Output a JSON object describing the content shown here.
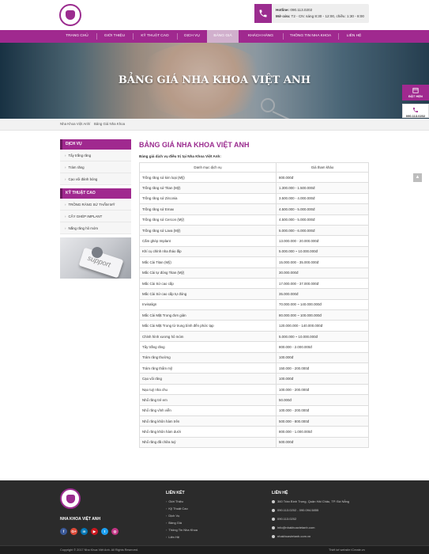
{
  "header": {
    "logo_icon": "tooth-logo",
    "hotline_label": "Hotline:",
    "hotline_value": "090.113.0202",
    "hours_label": "Mở cửa:",
    "hours_value": "T2 - CN: sáng 8:30 - 12:00, chiều: 1:30 - 8:00"
  },
  "nav": {
    "items": [
      {
        "label": "Trang chủ"
      },
      {
        "label": "Giới thiệu"
      },
      {
        "label": "Kỹ thuật cao"
      },
      {
        "label": "Dịch vụ"
      },
      {
        "label": "Bảng giá"
      },
      {
        "label": "Khách hàng"
      },
      {
        "label": "Thông tin nha khoa"
      },
      {
        "label": "Liên hệ"
      }
    ],
    "active_index": 4
  },
  "banner": {
    "title": "BẢNG GIÁ NHA KHOA VIỆT ANH"
  },
  "float_buttons": {
    "book_label": "ĐẶT HẸN",
    "call_label": "090.113.0202"
  },
  "breadcrumb": {
    "home": "Nha Khoa Việt Anh",
    "separator": "/",
    "current": "Bảng Giá Nha Khoa"
  },
  "sidebar": {
    "section1_title": "Dịch vụ",
    "section1_items": [
      "Tẩy trắng răng",
      "Trám răng",
      "Cạo vôi đánh bóng"
    ],
    "section2_title": "Kỹ thuật cao",
    "section2_items": [
      "TRỒNG RĂNG SỨ THẨM MỸ",
      "CẤY GHÉP IMPLANT",
      "Nắng răng hô móm"
    ],
    "support_text": "support"
  },
  "main": {
    "title": "BẢNG GIÁ NHA KHOA VIỆT ANH",
    "subtitle": "Bảng giá dịch vụ điều trị tại Nha Khoa Việt Anh:",
    "col_service": "Danh mục dịch vụ",
    "col_price": "Giá tham khảo",
    "rows": [
      [
        "Trồng răng sứ kim loại (Mỹ)",
        "800.000đ"
      ],
      [
        "Trồng răng sứ Titan (Mỹ)",
        "1.300.000 - 1.500.000đ"
      ],
      [
        "Trồng răng sứ Zirconia",
        "3.500.000 - 4.000.000đ"
      ],
      [
        "Trồng răng sứ Emax",
        "4.500.000 - 5.000.000đ"
      ],
      [
        "Trồng răng sứ Cercon (Mỹ)",
        "4.500.000 - 5.000.000đ"
      ],
      [
        "Trồng răng sứ Lava (Mỹ)",
        "5.000.000 - 6.000.000đ"
      ],
      [
        "Cấm ghép Implant",
        "13.000.000 - 20.000.000đ"
      ],
      [
        "Khí cụ chỉnh nha tháo lắp",
        "5.000.000 ~ 10.000.000đ"
      ],
      [
        "Mắc Cài Titan (Mỹ)",
        "15.000.000 - 35.000.000đ"
      ],
      [
        "Mắc Cài tự đóng Titan (Mỹ)",
        "30.000.000đ"
      ],
      [
        "Mắc Cài Sứ cao cấp",
        "17.000.000 - 37.000.000đ"
      ],
      [
        "Mắc Cài Sứ cao cấp tự đóng",
        "35.000.000đ"
      ],
      [
        "Invisalign",
        "70.000.000 ~ 140.000.000đ"
      ],
      [
        "Mắc Cài Mặt Trong đơn giản",
        "80.000.000 ~ 100.000.000đ"
      ],
      [
        "Mắc Cài Mặt Trong từ trung bình đến phức tạp",
        "120.000.000 - 140.000.000đ"
      ],
      [
        "Chỉnh hình xương hô móm",
        "5.000.000 ~ 10.000.000đ"
      ],
      [
        "Tẩy trắng răng",
        "800.000 - 2.000.000đ"
      ],
      [
        "Trám răng thường",
        "100.000đ"
      ],
      [
        "Trám răng thẩm mỹ",
        "150.000 - 200.000đ"
      ],
      [
        "Cạo vôi răng",
        "100.000đ"
      ],
      [
        "Nạo tuỷ nha chu",
        "100.000 - 200.000đ"
      ],
      [
        "Nhổ răng trẻ em",
        "50.000đ"
      ],
      [
        "Nhổ răng vĩnh viễn",
        "100.000 - 200.000đ"
      ],
      [
        "Nhổ răng khôn hàm trên",
        "500.000 - 800.000đ"
      ],
      [
        "Nhổ răng khôn hàm dưới",
        "800.000 - 1.000.000đ"
      ],
      [
        "Nhổ răng đã chữa tuỷ",
        "500.000đ"
      ]
    ]
  },
  "footer": {
    "brand": "NHA KHOA VIỆT ANH",
    "social": [
      "f",
      "G+",
      "in",
      "▶",
      "t",
      "◎"
    ],
    "links_title": "Liên kết",
    "links": [
      "Giới Thiệu",
      "Kỹ Thuật Cao",
      "Dịch Vụ",
      "Bảng Giá",
      "Thông Tin Nha Khoa",
      "Liên Hệ"
    ],
    "contact_title": "Liên hệ",
    "contact": [
      "360 Trần Bình Trọng, Quận Hải Châu, TP. Đà Nẵng",
      "090.113.0202 - 090.094.5855",
      "090.113.0202",
      "info@nhakhoavietanh.com",
      "nhakhoavietanh.com.vn"
    ],
    "copyright": "Copyright © 2017 Nha Khoa Việt Anh. All Rights Reserved.",
    "credit": "Thiết kế website iCreate.vn"
  },
  "colors": {
    "brand_purple": "#a0298f",
    "active_tab": "#d1b0cd",
    "footer_bg": "#2b2b2b"
  }
}
